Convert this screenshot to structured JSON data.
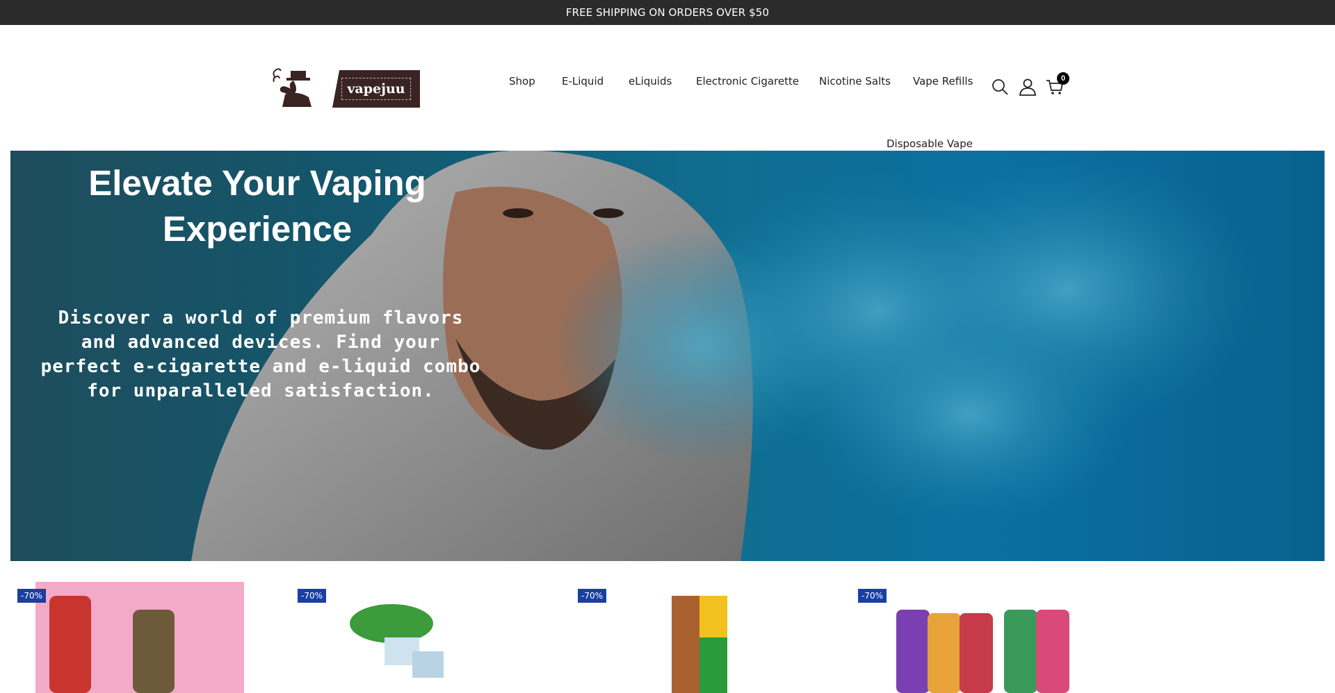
{
  "announcement": "FREE SHIPPING ON ORDERS OVER $50",
  "brand": {
    "logo_text": "vapejuu",
    "colors": {
      "badge": "#3a2423",
      "accent": "#1a3fa3"
    }
  },
  "nav": {
    "items": [
      {
        "label": "Shop"
      },
      {
        "label": "E-Liquid"
      },
      {
        "label": "eLiquids"
      },
      {
        "label": "Electronic Cigarette"
      },
      {
        "label": "Nicotine Salts"
      },
      {
        "label": "Vape Refills"
      },
      {
        "label": "Disposable Vape"
      }
    ]
  },
  "header_icons": {
    "search": "search-icon",
    "account": "user-icon",
    "cart": "cart-icon",
    "cart_count": "0"
  },
  "hero": {
    "heading": "Elevate Your Vaping Experience",
    "subheading": "Discover a world of premium flavors and advanced devices. Find your perfect e-cigarette and e-liquid combo for unparalleled satisfaction."
  },
  "products": [
    {
      "discount": "-70%"
    },
    {
      "discount": "-70%"
    },
    {
      "discount": "-70%"
    },
    {
      "discount": "-70%"
    }
  ]
}
